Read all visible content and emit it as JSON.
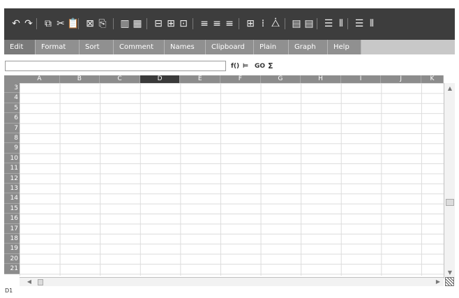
{
  "toolbar": {
    "buttons": [
      {
        "icon": "undo-icon",
        "glyph": "↶"
      },
      {
        "icon": "redo-icon",
        "glyph": "↷"
      },
      {
        "icon": "copy-icon",
        "glyph": "⧉"
      },
      {
        "icon": "cut-icon",
        "glyph": "✂"
      },
      {
        "icon": "paste-icon",
        "glyph": "📋"
      },
      {
        "icon": "clear-icon",
        "glyph": "⊠"
      },
      {
        "icon": "paste-special-icon",
        "glyph": "⎘"
      },
      {
        "icon": "insert-column-icon",
        "glyph": "▥"
      },
      {
        "icon": "delete-column-icon",
        "glyph": "▦"
      },
      {
        "icon": "insert-row-icon",
        "glyph": "⊟"
      },
      {
        "icon": "insert-cells-icon",
        "glyph": "⊞"
      },
      {
        "icon": "delete-cells-icon",
        "glyph": "⊡"
      },
      {
        "icon": "align-left-icon",
        "glyph": "≡"
      },
      {
        "icon": "align-center-icon",
        "glyph": "≡"
      },
      {
        "icon": "align-right-icon",
        "glyph": "≡"
      },
      {
        "icon": "borders-icon",
        "glyph": "⊞"
      },
      {
        "icon": "no-borders-icon",
        "glyph": "⁞"
      },
      {
        "icon": "fill-color-icon",
        "glyph": "⧊"
      },
      {
        "icon": "merge-cells-icon",
        "glyph": "▤"
      },
      {
        "icon": "split-cells-icon",
        "glyph": "▤"
      },
      {
        "icon": "row-height-icon",
        "glyph": "☰"
      },
      {
        "icon": "column-width-icon",
        "glyph": "⦀"
      },
      {
        "icon": "autofit-rows-icon",
        "glyph": "☰"
      },
      {
        "icon": "autofit-columns-icon",
        "glyph": "⦀"
      }
    ]
  },
  "tabs": [
    {
      "label": "Edit",
      "active": true
    },
    {
      "label": "Format",
      "active": false
    },
    {
      "label": "Sort",
      "active": false
    },
    {
      "label": "Comment",
      "active": false
    },
    {
      "label": "Names",
      "active": false
    },
    {
      "label": "Clipboard",
      "active": false
    },
    {
      "label": "Plain",
      "active": false
    },
    {
      "label": "Graph",
      "active": false
    },
    {
      "label": "Help",
      "active": false
    }
  ],
  "formula": {
    "value": "",
    "function_label": "f()",
    "align_label": "⊨",
    "link_label": "GO",
    "sum_label": "Σ"
  },
  "grid": {
    "columns": [
      "A",
      "B",
      "C",
      "D",
      "E",
      "F",
      "G",
      "H",
      "I",
      "J",
      "K"
    ],
    "selected_column": "D",
    "rows": [
      "3",
      "4",
      "5",
      "6",
      "7",
      "8",
      "9",
      "10",
      "11",
      "12",
      "13",
      "14",
      "15",
      "16",
      "17",
      "18",
      "19",
      "20",
      "21"
    ]
  },
  "status": {
    "cell_ref": "D1"
  },
  "colors": {
    "toolbar_bg": "#3d3d3d",
    "tab_bg": "#909090",
    "header_bg": "#8c8c8c",
    "selected_header_bg": "#3a3a3a"
  }
}
